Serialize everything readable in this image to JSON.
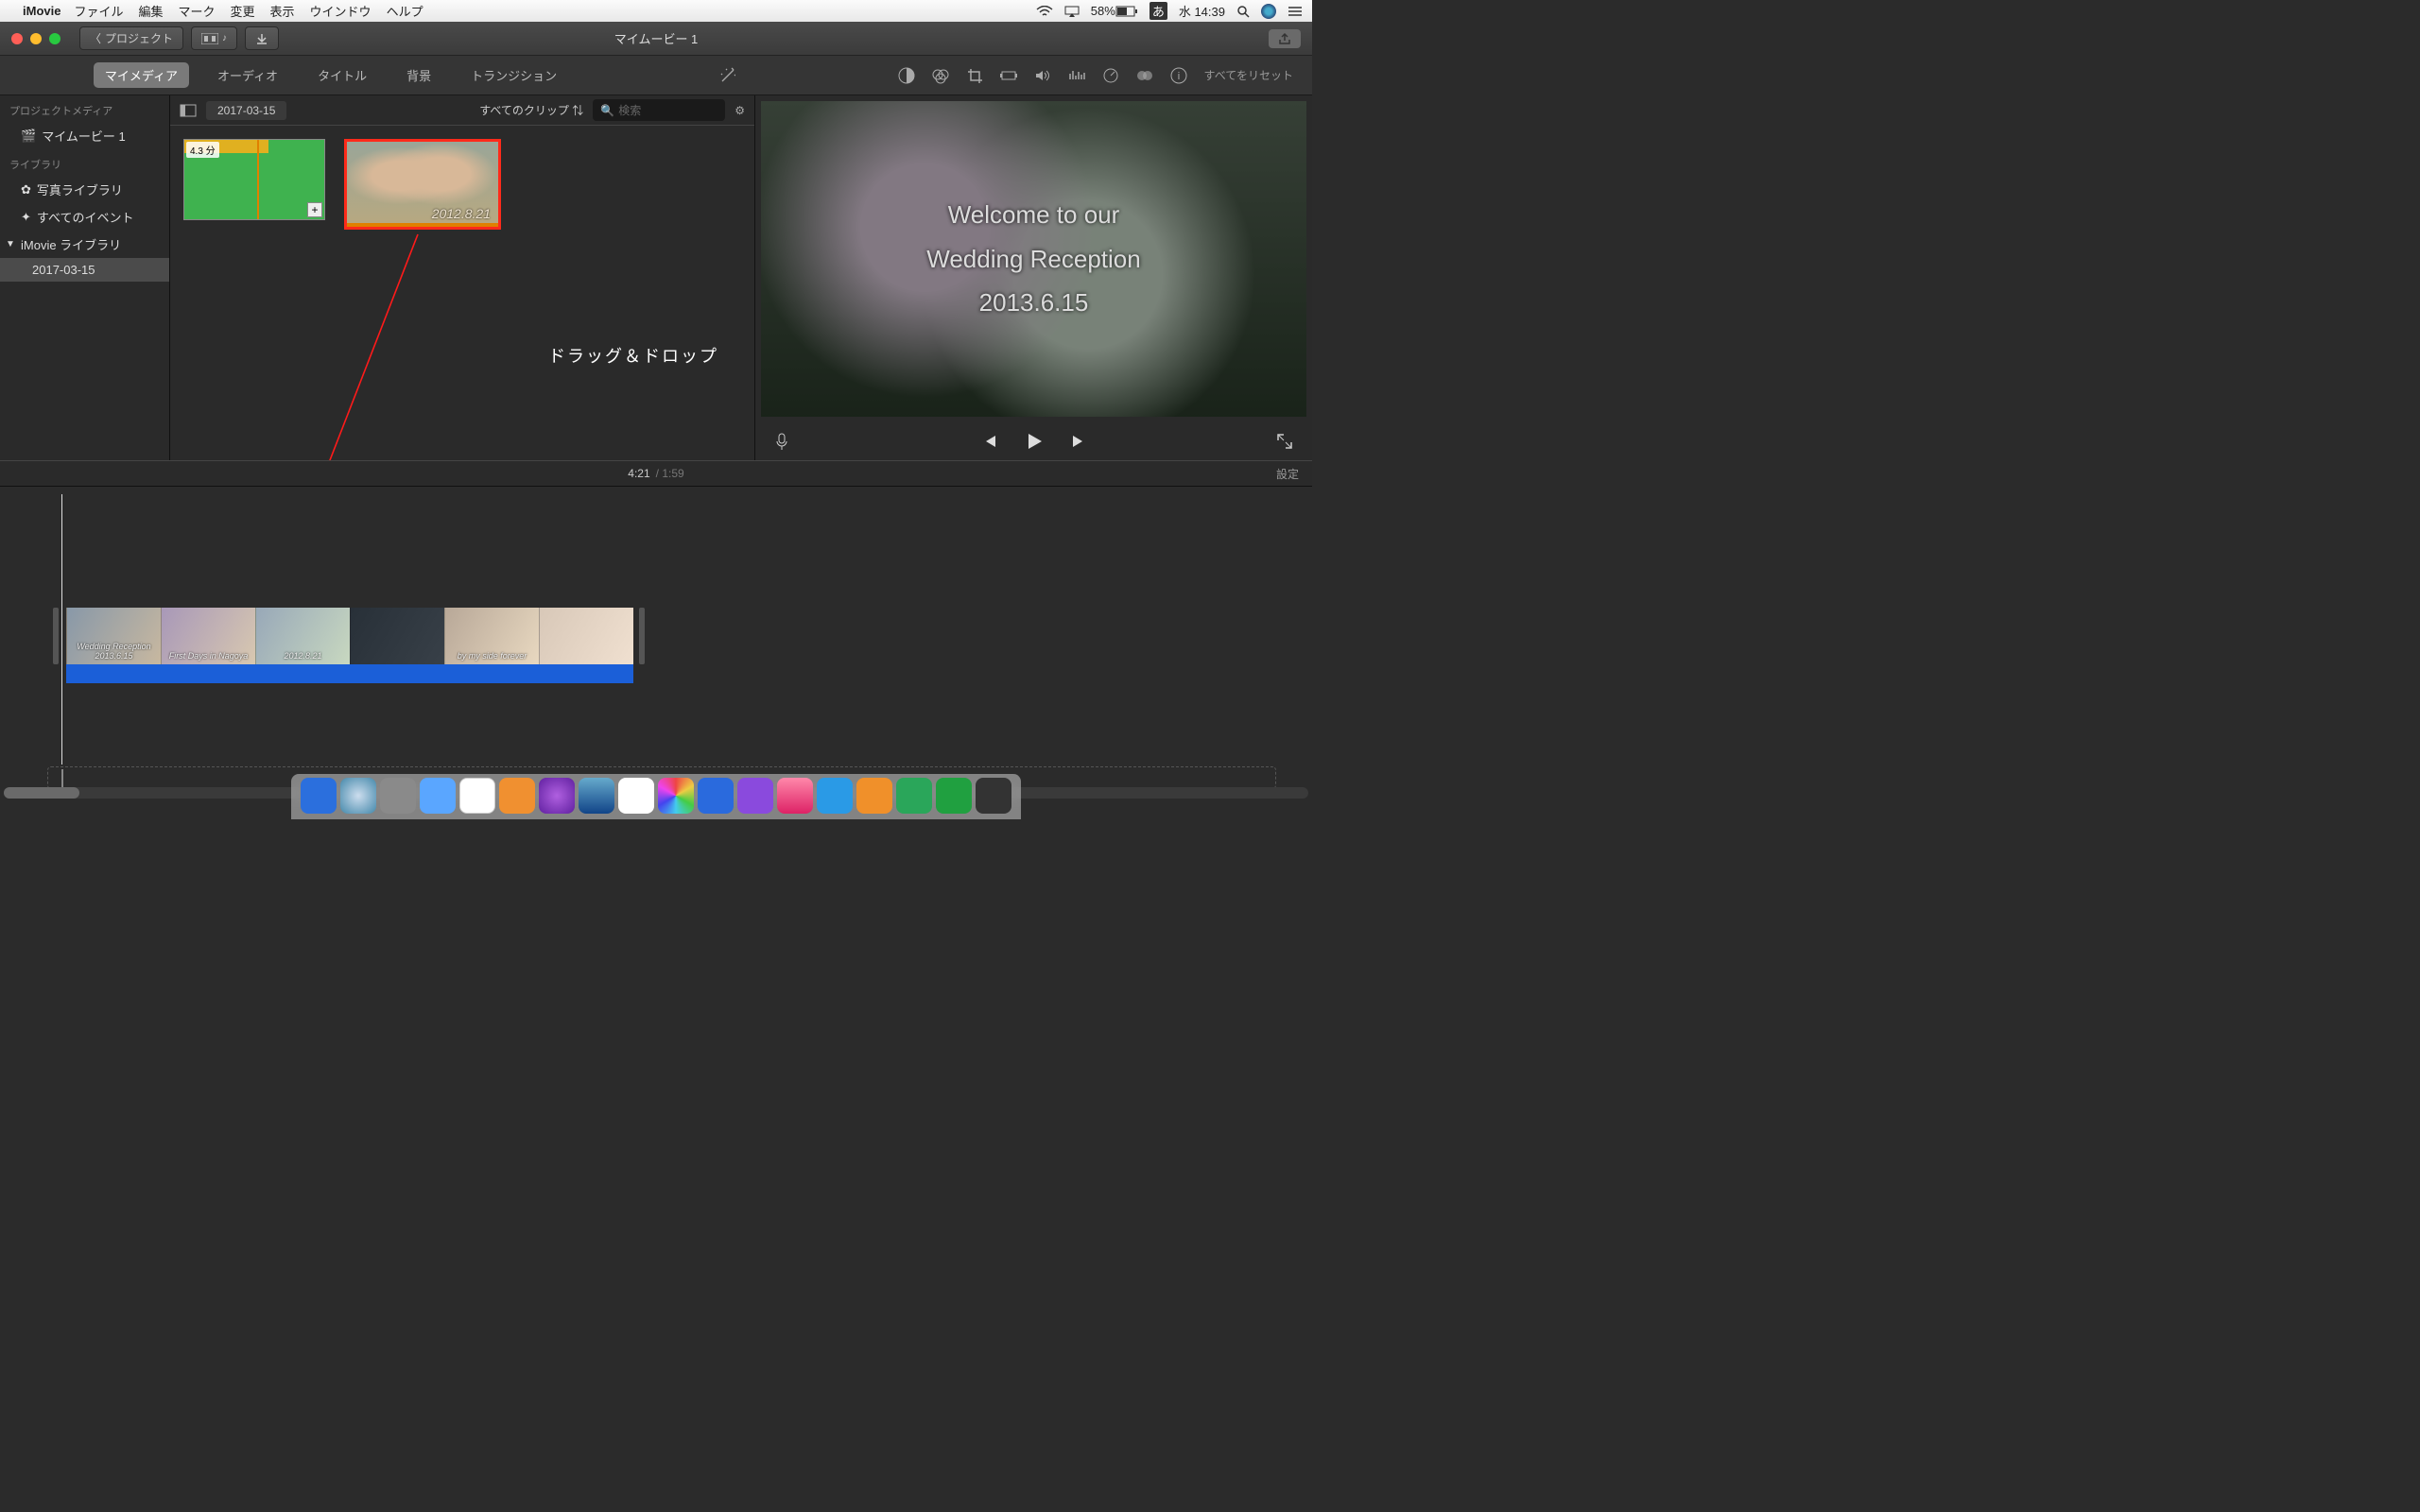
{
  "menubar": {
    "app": "iMovie",
    "items": [
      "ファイル",
      "編集",
      "マーク",
      "変更",
      "表示",
      "ウインドウ",
      "ヘルプ"
    ],
    "battery": "58%",
    "ime": "あ",
    "clock": "水 14:39"
  },
  "titlebar": {
    "back_label": "プロジェクト",
    "title": "マイムービー 1"
  },
  "tabs": {
    "items": [
      "マイメディア",
      "オーディオ",
      "タイトル",
      "背景",
      "トランジション"
    ],
    "active_index": 0
  },
  "adjust_tools": {
    "reset_label": "すべてをリセット"
  },
  "sidebar": {
    "section1": "プロジェクトメディア",
    "project": "マイムービー 1",
    "section2": "ライブラリ",
    "photo_lib": "写真ライブラリ",
    "all_events": "すべてのイベント",
    "imovie_lib": "iMovie ライブラリ",
    "event": "2017-03-15"
  },
  "browser": {
    "date": "2017-03-15",
    "clip_filter": "すべてのクリップ",
    "search_placeholder": "検索",
    "clip1_duration": "4.3 分",
    "clip2_stamp": "2012.8.21"
  },
  "annotation": {
    "text": "ドラッグ＆ドロップ"
  },
  "preview": {
    "line1": "Welcome to our",
    "line2": "Wedding Reception",
    "line3": "2013.6.15"
  },
  "timecode": {
    "current": "4:21",
    "total": "1:59",
    "settings": "設定"
  },
  "timeline": {
    "frames": [
      "Wedding Reception 2013.6.15",
      "First Days in Nagoya",
      "2012.8.21",
      "",
      "by my side forever",
      ""
    ]
  },
  "dock_colors": [
    "#2b6fdd",
    "#4aa0e6",
    "#8a8a8a",
    "#5aa6ff",
    "#d44",
    "#f0902a",
    "#7a3ad6",
    "#2a7ad6",
    "#e6443a",
    "#d6a62a",
    "#2a6ad6",
    "#8a4ad6",
    "#e65a9a",
    "#2a9ae6",
    "#e6862a",
    "#2aa65a",
    "#5a9a2a",
    "#2a2a2a"
  ]
}
